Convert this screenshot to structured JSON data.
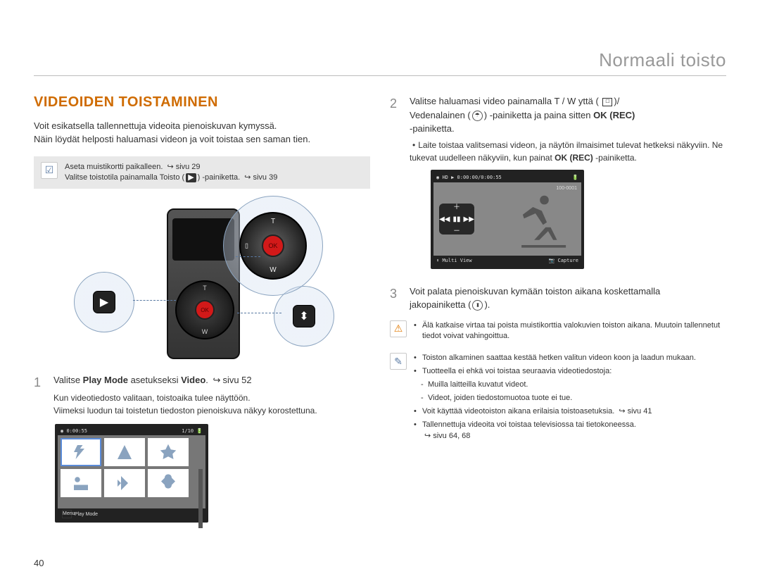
{
  "header": {
    "title": "Normaali toisto"
  },
  "left": {
    "sectionTitle": "VIDEOIDEN TOISTAMINEN",
    "intro1": "Voit esikatsella tallennettuja videoita pienoiskuvan kymyssä.",
    "intro2": "Näin löydät helposti haluamasi videon ja voit toistaa sen saman tien.",
    "greybox": {
      "line1a": "Aseta muistikortti paikalleen.",
      "line1b": "sivu 29",
      "line2a": "Valitse toistotila painamalla Toisto (",
      "line2b": ") -painiketta.",
      "line2c": "sivu 39"
    },
    "callouts": {
      "play": "▶",
      "share": "⬍",
      "t": "T",
      "w": "W",
      "left": "▯",
      "ok": "OK"
    },
    "step1": {
      "text_a": "Valitse ",
      "bold": "Play Mode",
      "text_b": " asetukseksi ",
      "bold2": "Video",
      "text_c": ". ",
      "page_ref": "sivu 52",
      "desc1": "Kun videotiedosto valitaan, toistoaika tulee näyttöön.",
      "desc2": "Viimeksi luodun tai toistetun tiedoston pienoiskuva näkyy korostettuna."
    },
    "lcd1": {
      "time": "0:00:55",
      "count": "1/10",
      "menu": "Menu",
      "mode": "Play Mode"
    }
  },
  "right": {
    "step2": {
      "line1a": "Valitse haluamasi video painamalla T / W yttä (",
      "line1b": ")/",
      "line2a": "Vedenalainen (",
      "line2b": ") -painiketta ja paina sitten ",
      "line2c": "OK (REC)",
      "line3": "-painiketta.",
      "desc1": "Laite toistaa valitsemasi videon, ja näytön ilmaisimet tulevat hetkeksi näkyviin. Ne tukevat uudelleen näkyviin, kun painat ",
      "desc1b": "OK (REC)",
      "desc1c": " -painiketta."
    },
    "lcd2": {
      "hd": "HD",
      "time": "0:00:00/0:00:55",
      "file": "100-0001",
      "multiview": "Multi View",
      "capture": "Capture",
      "plus": "＋",
      "minus": "－",
      "prev": "◀◀",
      "pause": "▮▮",
      "next": "▶▶"
    },
    "step3": {
      "line_a": "Voit palata pienoiskuvan kymään toiston aikana koskettamalla",
      "line_b": "jakopainiketta (",
      "line_c": ")."
    },
    "warn": {
      "line1": "Älä katkaise virtaa tai poista muistikorttia valokuvien toiston aikana.",
      "line2": "Muutoin tallennetut tiedot voivat vahingoittua."
    },
    "info": {
      "l1": "Toiston alkaminen saattaa kestää hetken valitun videon koon ja laadun mukaan.",
      "l2": "Tuotteella ei ehkä voi toistaa seuraavia videotiedostoja:",
      "l2a": "Muilla laitteilla kuvatut videot.",
      "l2b": "Videot, joiden tiedostomuotoa tuote ei tue.",
      "l3a": "Voit käyttää videotoiston aikana erilaisia toistoasetuksia.",
      "l3b": "sivu 41",
      "l4a": "Tallennettuja videoita voi toistaa televisiossa tai tietokoneessa.",
      "l4b": "sivu 64, 68"
    }
  },
  "pageNumber": "40"
}
